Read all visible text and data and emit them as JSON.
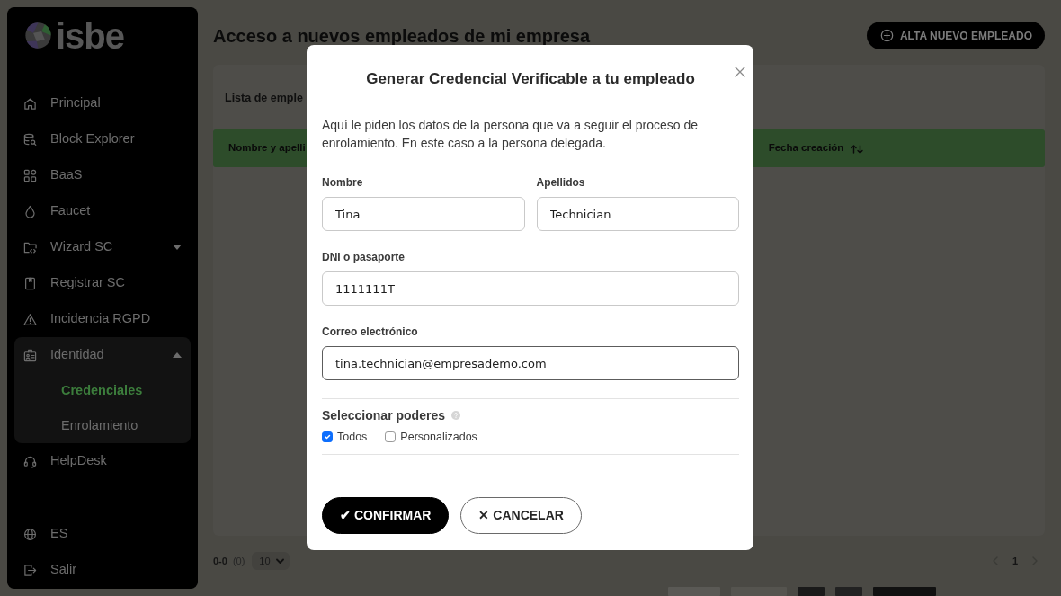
{
  "sidebar": {
    "brand": "isbe",
    "items": [
      {
        "label": "Principal",
        "selected": false
      },
      {
        "label": "Block Explorer",
        "selected": false
      },
      {
        "label": "BaaS",
        "selected": false
      },
      {
        "label": "Faucet",
        "selected": false
      },
      {
        "label": "Wizard SC",
        "selected": false,
        "expanded": false
      },
      {
        "label": "Registrar SC",
        "selected": false
      },
      {
        "label": "Incidencia RGPD",
        "selected": false
      },
      {
        "label": "Identidad",
        "selected": false,
        "expanded": true,
        "children": [
          {
            "label": "Credenciales",
            "selected": true
          },
          {
            "label": "Enrolamiento",
            "selected": false
          }
        ]
      },
      {
        "label": "HelpDesk",
        "selected": false
      }
    ],
    "footer_items": [
      {
        "label": "ES"
      },
      {
        "label": "Salir"
      }
    ]
  },
  "page": {
    "title": "Acceso a nuevos empleados de mi empresa",
    "add_button": "ALTA NUEVO EMPLEADO"
  },
  "list_card": {
    "title": "Lista de emple",
    "columns": [
      {
        "label": "Nombre y apelli",
        "sortable": false
      },
      {
        "label": "Fecha creación",
        "sortable": true
      }
    ]
  },
  "pagination": {
    "range": "0-0",
    "total": "(0)",
    "page_size": "10",
    "pages": [
      {
        "label": "1",
        "selected": true
      }
    ]
  },
  "modal": {
    "title": "Generar Credencial Verificable a tu empleado",
    "intro": "Aquí le piden los datos de la persona que va a seguir el proceso de enrolamiento. En este caso a la persona delegada.",
    "rows": [
      [
        {
          "label": "Nombre",
          "value": "Tina",
          "focused": false
        },
        {
          "label": "Apellidos",
          "value": "Technician",
          "focused": false
        }
      ],
      [
        {
          "label": "DNI o pasaporte",
          "value": "1111111T",
          "focused": false
        }
      ],
      [
        {
          "label": "Correo electrónico",
          "value": "tina.technician@empresademo.com",
          "focused": true
        }
      ]
    ],
    "powers": {
      "title": "Seleccionar poderes",
      "options": [
        {
          "label": "Todos",
          "checked": true
        },
        {
          "label": "Personalizados",
          "checked": false
        }
      ]
    },
    "buttons": [
      {
        "label": "✔ CONFIRMAR",
        "kind": "primary"
      },
      {
        "label": "✕ CANCELAR",
        "kind": "outline"
      }
    ]
  }
}
